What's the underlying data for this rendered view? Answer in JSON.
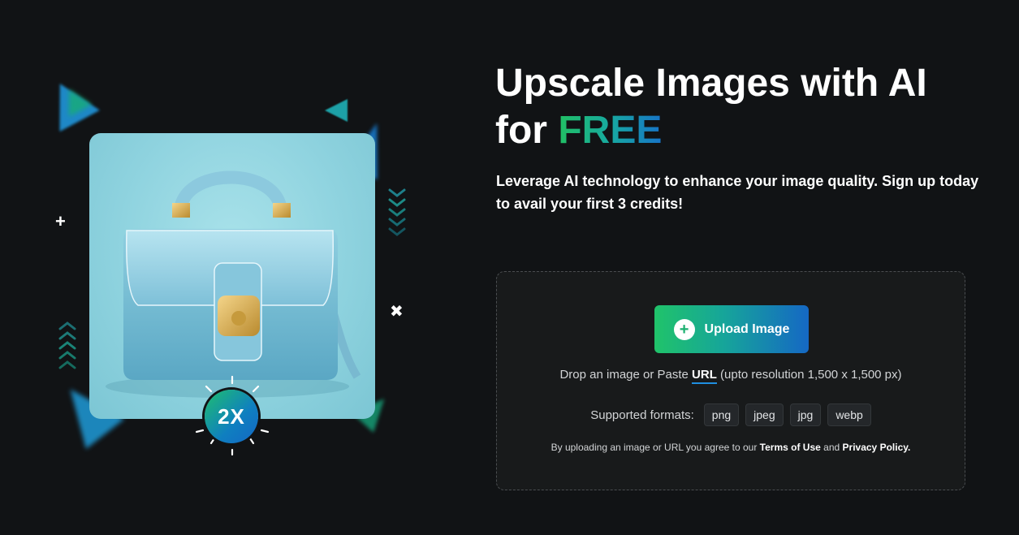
{
  "hero": {
    "title_line1": "Upscale Images with AI",
    "title_for": "for",
    "title_free": "FREE",
    "subtitle": "Leverage AI technology to enhance your image quality. Sign up today to avail your first 3 credits!"
  },
  "illustration": {
    "badge_label": "2X",
    "plus_glyph": "+",
    "close_glyph": "✖"
  },
  "upload": {
    "button_label": "Upload Image",
    "button_icon": "plus-circle-icon",
    "drop_prefix": "Drop an image or Paste",
    "url_label": "URL",
    "drop_suffix": "(upto resolution 1,500 x 1,500 px)",
    "formats_label": "Supported formats:",
    "formats": [
      "png",
      "jpeg",
      "jpg",
      "webp"
    ],
    "terms_prefix": "By uploading an image or URL you agree to our",
    "terms_link": "Terms of Use",
    "terms_and": "and",
    "privacy_link": "Privacy Policy."
  },
  "colors": {
    "background": "#111315",
    "accent_green": "#20c36a",
    "accent_blue": "#1568c4",
    "dropzone_bg": "#181a1b"
  }
}
